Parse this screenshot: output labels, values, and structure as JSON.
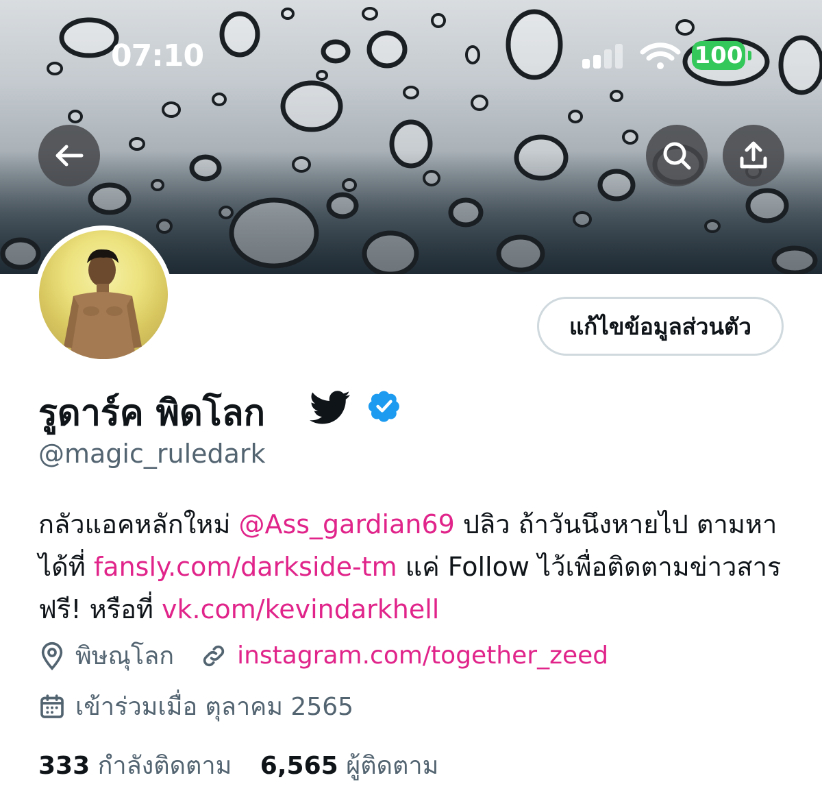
{
  "status_bar": {
    "time": "07:10",
    "battery": "100",
    "colors": {
      "battery": "#34c759"
    },
    "icons": [
      "cellular-signal-icon",
      "wifi-icon",
      "battery-icon"
    ]
  },
  "header": {
    "back_icon": "arrow-left-icon",
    "search_icon": "search-icon",
    "share_icon": "share-upload-icon"
  },
  "profile": {
    "edit_button": "แก้ไขข้อมูลส่วนตัว",
    "display_name": "รูดาร์ค พิดโลก",
    "name_badges": [
      "twitter-bird-icon",
      "verified-badge-icon"
    ],
    "handle": "@magic_ruledark",
    "bio": {
      "part1": "กลัวแอคหลักใหม่ ",
      "mention": "@Ass_gardian69",
      "part2": " ปลิว ถ้าวันนึงหายไป ตามหาได้ที่ ",
      "link1": "fansly.com/darkside-tm",
      "part3": " แค่ Follow ไว้เพื่อติดตามข่าวสาร ฟรี! หรือที่ ",
      "link2": "vk.com/kevindarkhell"
    },
    "location": "พิษณุโลก",
    "website": "instagram.com/together_zeed",
    "joined": "เข้าร่วมเมื่อ ตุลาคม 2565",
    "following_count": "333",
    "following_label": "กำลังติดตาม",
    "followers_count": "6,565",
    "followers_label": "ผู้ติดตาม"
  },
  "colors": {
    "link": "#e0248a",
    "secondary_text": "#536471",
    "verified": "#1d9bf0"
  }
}
